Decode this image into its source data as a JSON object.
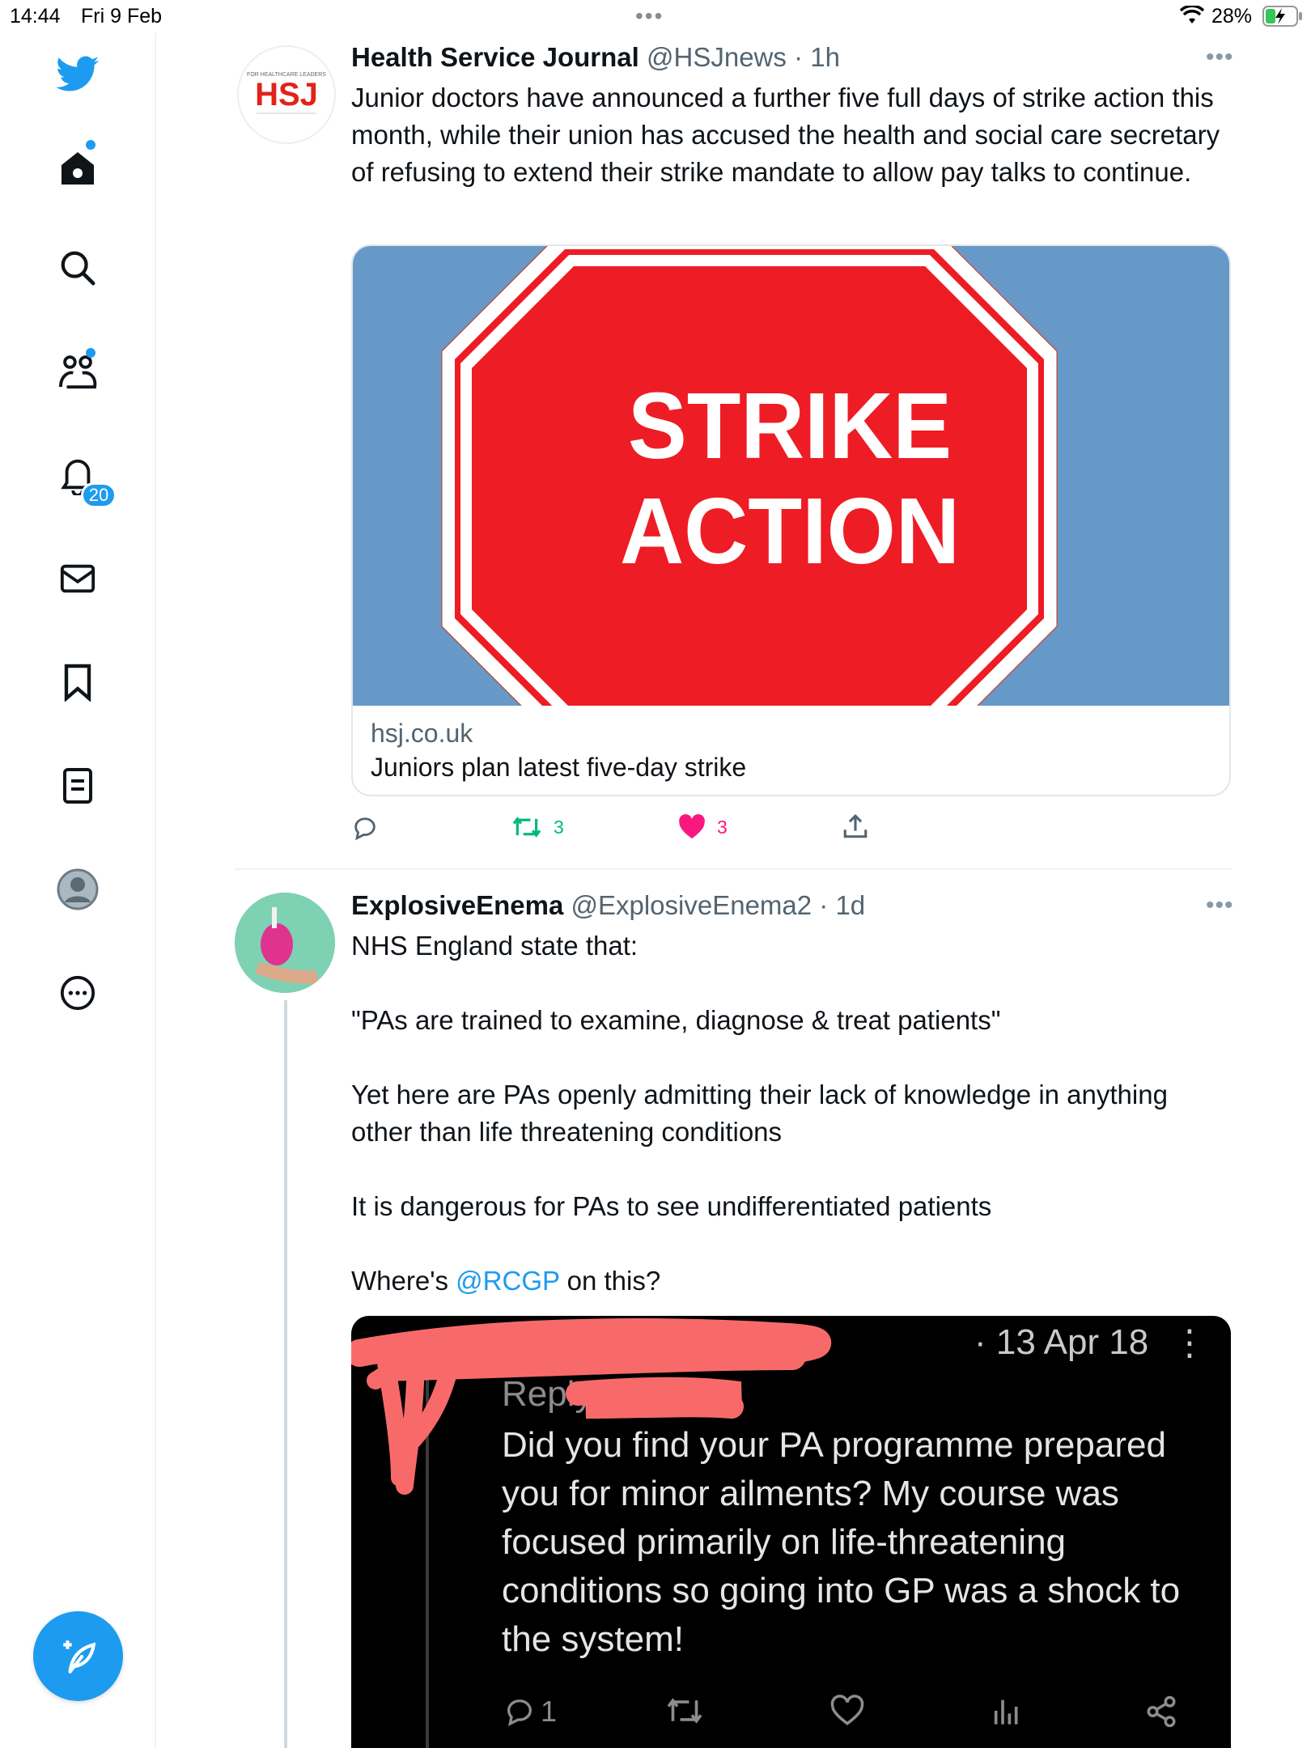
{
  "status_bar": {
    "time": "14:44",
    "date": "Fri 9 Feb",
    "battery_percent": "28%"
  },
  "sidebar": {
    "items": [
      {
        "icon": "twitter-logo-icon"
      },
      {
        "icon": "home-icon"
      },
      {
        "icon": "search-icon"
      },
      {
        "icon": "communities-icon"
      },
      {
        "icon": "bell-icon",
        "badge": "20"
      },
      {
        "icon": "mail-icon"
      },
      {
        "icon": "bookmark-icon"
      },
      {
        "icon": "lists-icon"
      },
      {
        "icon": "profile-icon"
      },
      {
        "icon": "more-circle-icon"
      }
    ],
    "compose_icon": "compose-feather-icon"
  },
  "tweets": [
    {
      "name": "Health Service Journal",
      "handle": "@HSJnews",
      "time": "· 1h",
      "avatar_text": "HSJ",
      "avatar_tag": "FOR HEALTHCARE LEADERS",
      "text": "Junior doctors have announced a further five full days of strike action this month, while their union has accused the health and social care secretary of refusing to extend their strike mandate to allow pay talks to continue.",
      "card": {
        "sign_line1": "STRIKE",
        "sign_line2": "ACTION",
        "domain": "hsj.co.uk",
        "title": "Juniors plan latest five-day strike"
      },
      "retweets": "3",
      "likes": "3"
    },
    {
      "name": "ExplosiveEnema",
      "handle": "@ExplosiveEnema2",
      "time": "· 1d",
      "paragraphs": [
        "NHS England state that:",
        "\"PAs are trained to examine, diagnose & treat patients\"",
        "Yet here are PAs openly admitting their lack of knowledge in anything other than life threatening conditions",
        "It is dangerous for PAs to see undifferentiated patients"
      ],
      "last_prefix": "Where's ",
      "last_mention": "@RCGP",
      "last_suffix": " on this?",
      "embedded": {
        "date": "· 13 Apr 18",
        "replying": "Replying t",
        "text": "Did you find your PA programme prepared you for minor ailments? My course was focused primarily on life-threatening conditions so going into GP was a shock to the system!",
        "replies": "1"
      }
    }
  ],
  "colors": {
    "accent": "#1d9bf0",
    "like": "#f91880",
    "retweet": "#00ba7c",
    "sign_red": "#ee1c25",
    "card_sky": "#6699c8",
    "redaction": "#f86a6a"
  }
}
